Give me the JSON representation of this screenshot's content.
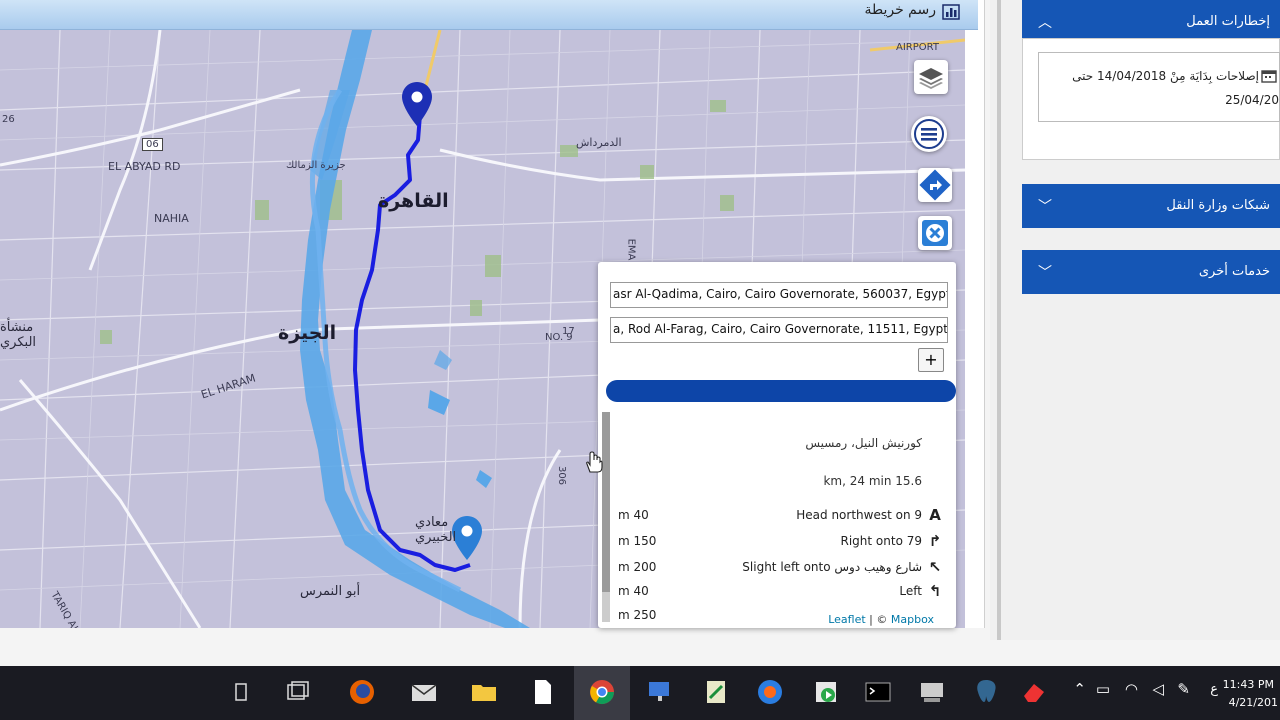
{
  "map_panel": {
    "title": "رسم خريطة",
    "labels": {
      "cairo": "القاهرة",
      "giza": "الجيزة",
      "manshat_bakry": "منشأة\nالبكري",
      "maadi": "معادي\nالخبيري",
      "abu_el_nomros": "أبو النمرس",
      "el_abyad": "EL ABYAD RD",
      "nahia": "NAHIA",
      "el_haram": "EL HARAM",
      "tariq": "TARIQ AL MANSUREYA",
      "airport": "AIRPORT",
      "road_06": "06",
      "road_26": "26",
      "demerdash": "الدمرداش",
      "zamalek": "جزيرة الزمالك",
      "no9": "NO. 9",
      "road_17": "17",
      "road_306": "306",
      "emad": "EMA"
    }
  },
  "routing": {
    "start_value": "asr Al-Qadima, Cairo, Cairo Governorate, 560037, Egypt",
    "end_value": "a, Rod Al-Farag, Cairo, Cairo Governorate, 11511, Egypt",
    "add_label": "+",
    "route_name": "كورنيش النيل، رمسيس",
    "summary": "km, 24 min 15.6",
    "instructions": [
      {
        "text": "Head northwest on 9",
        "icon": "A",
        "dist": "m 40"
      },
      {
        "text": "Right onto 79",
        "icon": "↱",
        "dist": "m 150"
      },
      {
        "text": "Slight left onto شارع وهيب دوس",
        "icon": "↖",
        "dist": "m 200"
      },
      {
        "text": "Left",
        "icon": "↰",
        "dist": "m 40"
      },
      {
        "text": "",
        "icon": "",
        "dist": "m 250"
      }
    ],
    "attribution_leaflet": "Leaflet",
    "attribution_sep": " | © ",
    "attribution_mapbox": "Mapbox"
  },
  "sidebar": {
    "section1_title": "إخطارات العمل",
    "alert_line1": "إصلاحات بِدَايَة مِنْ 14/04/2018 حتى",
    "alert_line2": "25/04/20",
    "section2_title": "شبكات وزارة النقل",
    "section3_title": "خدمات أخرى"
  },
  "taskbar": {
    "time": "11:43 PM",
    "date": "4/21/201",
    "lang": "ع"
  },
  "colors": {
    "accent": "#1556b5",
    "route_dark": "#1a1ee0",
    "route_light": "#5aa7e8",
    "map_bg": "#c3c1da"
  }
}
